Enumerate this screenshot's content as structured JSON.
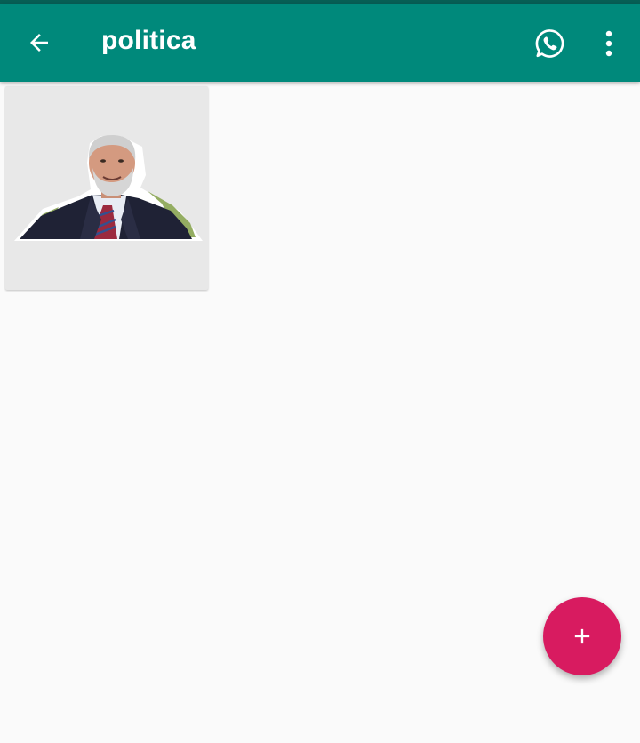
{
  "toolbar": {
    "title": "politica",
    "back_icon": "arrow-back-icon",
    "share_icon": "whatsapp-icon",
    "menu_icon": "more-vert-icon"
  },
  "stickers": [
    {
      "icon": "sticker-portrait"
    }
  ],
  "fab": {
    "icon": "add-icon"
  },
  "colors": {
    "app_bar": "#00897b",
    "status_strip": "#075e54",
    "fab": "#d81b60",
    "background": "#fafafa",
    "card": "#e8e8e8"
  }
}
